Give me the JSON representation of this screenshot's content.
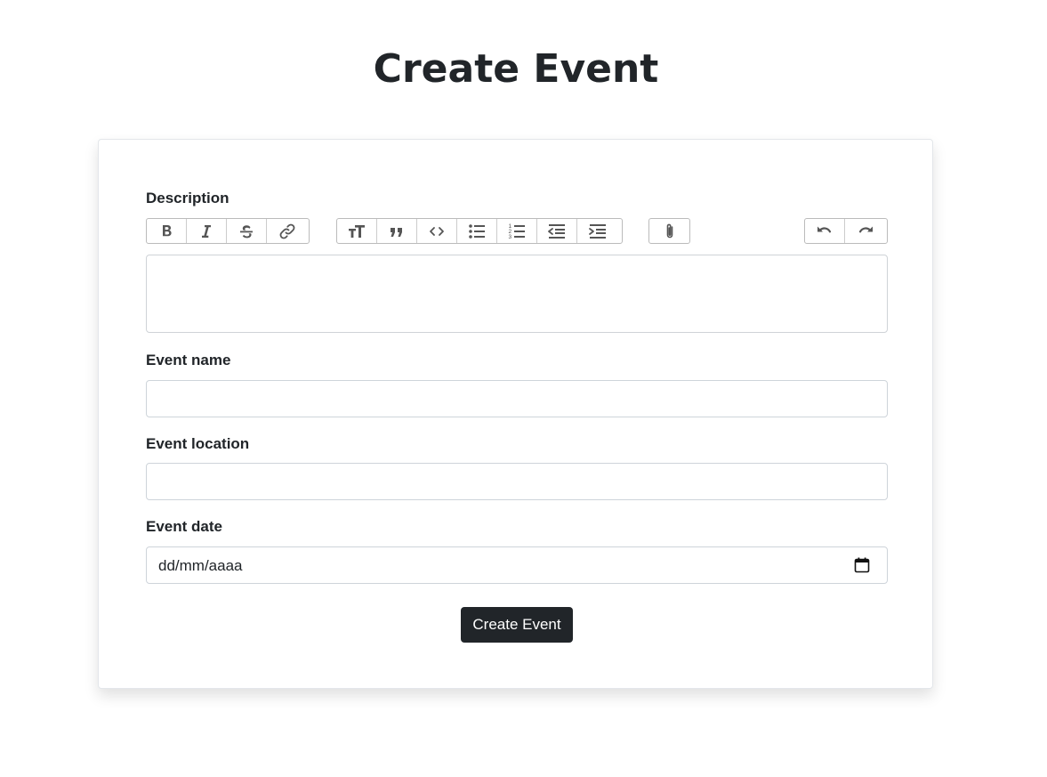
{
  "page": {
    "title": "Create Event"
  },
  "form": {
    "description_label": "Description",
    "description_value": "",
    "event_name_label": "Event name",
    "event_name_value": "",
    "event_location_label": "Event location",
    "event_location_value": "",
    "event_date_label": "Event date",
    "event_date_placeholder": "dd/mm/aaaa",
    "submit_label": "Create Event"
  },
  "toolbar": {
    "text_tools": [
      {
        "icon": "bold-icon",
        "title": "Bold"
      },
      {
        "icon": "italic-icon",
        "title": "Italic"
      },
      {
        "icon": "strikethrough-icon",
        "title": "Strikethrough"
      },
      {
        "icon": "link-icon",
        "title": "Link"
      }
    ],
    "block_tools": [
      {
        "icon": "heading-icon",
        "title": "Heading"
      },
      {
        "icon": "quote-icon",
        "title": "Quote"
      },
      {
        "icon": "code-icon",
        "title": "Code"
      },
      {
        "icon": "bullet-list-icon",
        "title": "Bullets"
      },
      {
        "icon": "numbered-list-icon",
        "title": "Numbers"
      },
      {
        "icon": "decrease-indent-icon",
        "title": "Decrease Level"
      },
      {
        "icon": "increase-indent-icon",
        "title": "Increase Level"
      }
    ],
    "file_tools": [
      {
        "icon": "paperclip-icon",
        "title": "Attach Files"
      }
    ],
    "history_tools": [
      {
        "icon": "undo-icon",
        "title": "Undo"
      },
      {
        "icon": "redo-icon",
        "title": "Redo"
      }
    ]
  },
  "colors": {
    "text": "#212529",
    "button_bg": "#212529",
    "button_text": "#ffffff",
    "border": "#ced4da",
    "icon": "#555555"
  }
}
